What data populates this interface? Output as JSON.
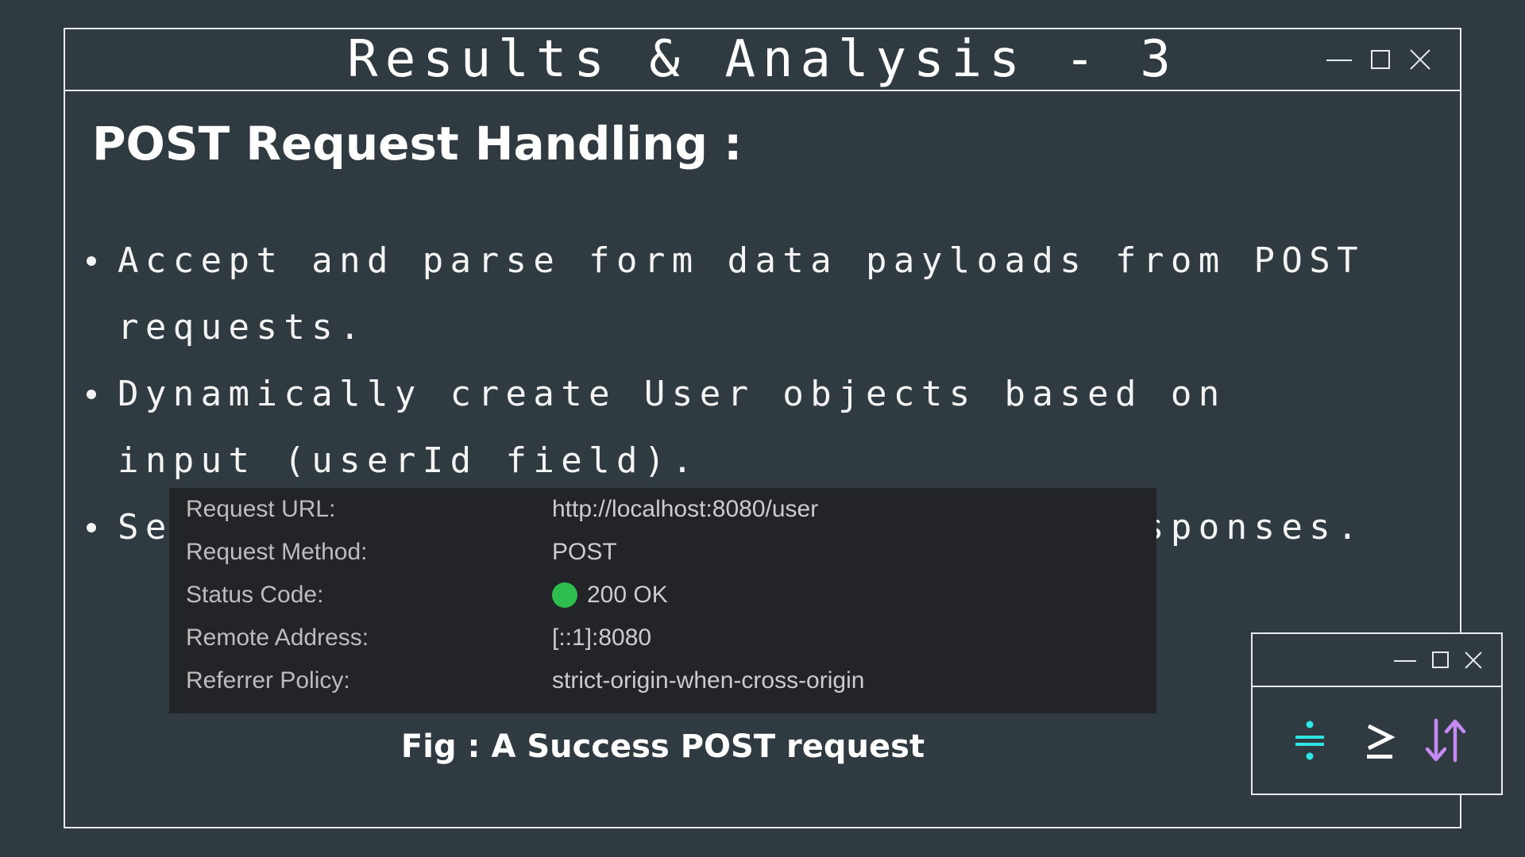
{
  "window": {
    "title": "Results & Analysis - 3"
  },
  "content": {
    "heading": "POST Request Handling :",
    "bullets": [
      "Accept and parse form data payloads from POST requests.",
      "Dynamically create User objects based on input (userId field).",
      "Serialize User objects to JSON for responses."
    ]
  },
  "figure": {
    "rows": [
      {
        "label": "Request URL:",
        "value": "http://localhost:8080/user"
      },
      {
        "label": "Request Method:",
        "value": "POST"
      },
      {
        "label": "Status Code:",
        "value": "200 OK",
        "status_color": "#2dbe4f"
      },
      {
        "label": "Remote Address:",
        "value": "[::1]:8080"
      },
      {
        "label": "Referrer Policy:",
        "value": "strict-origin-when-cross-origin"
      }
    ],
    "caption": "Fig : A Success POST request"
  },
  "mini_window": {
    "icons": [
      {
        "name": "divide-equals-icon",
        "color": "#2ee6e6"
      },
      {
        "name": "greater-equal-icon",
        "color": "#ffffff"
      },
      {
        "name": "sort-arrows-icon",
        "color": "#c58bf2"
      }
    ]
  },
  "colors": {
    "background": "#2f3b40",
    "border": "#e8ecee",
    "figure_background": "#222428"
  }
}
